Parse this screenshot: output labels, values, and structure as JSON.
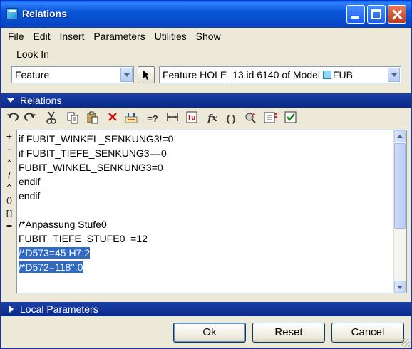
{
  "window": {
    "title": "Relations"
  },
  "menu": [
    "File",
    "Edit",
    "Insert",
    "Parameters",
    "Utilities",
    "Show"
  ],
  "lookin": {
    "label": "Look In",
    "type_value": "Feature",
    "model_value_prefix": "Feature HOLE_13 id 6140 of Model",
    "model_value_suffix": "FUB"
  },
  "relations_section": {
    "title": "Relations"
  },
  "side_operators": [
    "+",
    "–",
    "*",
    "/",
    "^",
    "()",
    "[]",
    "="
  ],
  "code_lines": [
    "if FUBIT_WINKEL_SENKUNG3!=0",
    "if FUBIT_TIEFE_SENKUNG3==0",
    "FUBIT_WINKEL_SENKUNG3=0",
    "endif",
    "endif",
    "",
    "/*Anpassung Stufe0",
    "FUBIT_TIEFE_STUFE0_=12",
    "/*D573=45 H7:2",
    "/*D572=118°:0"
  ],
  "local_parameters_section": {
    "title": "Local Parameters"
  },
  "buttons": {
    "ok": "Ok",
    "reset": "Reset",
    "cancel": "Cancel"
  },
  "colors": {
    "titlebar": "#0b56d8",
    "section_header": "#0a2a8a",
    "selection": "#316ac5"
  }
}
